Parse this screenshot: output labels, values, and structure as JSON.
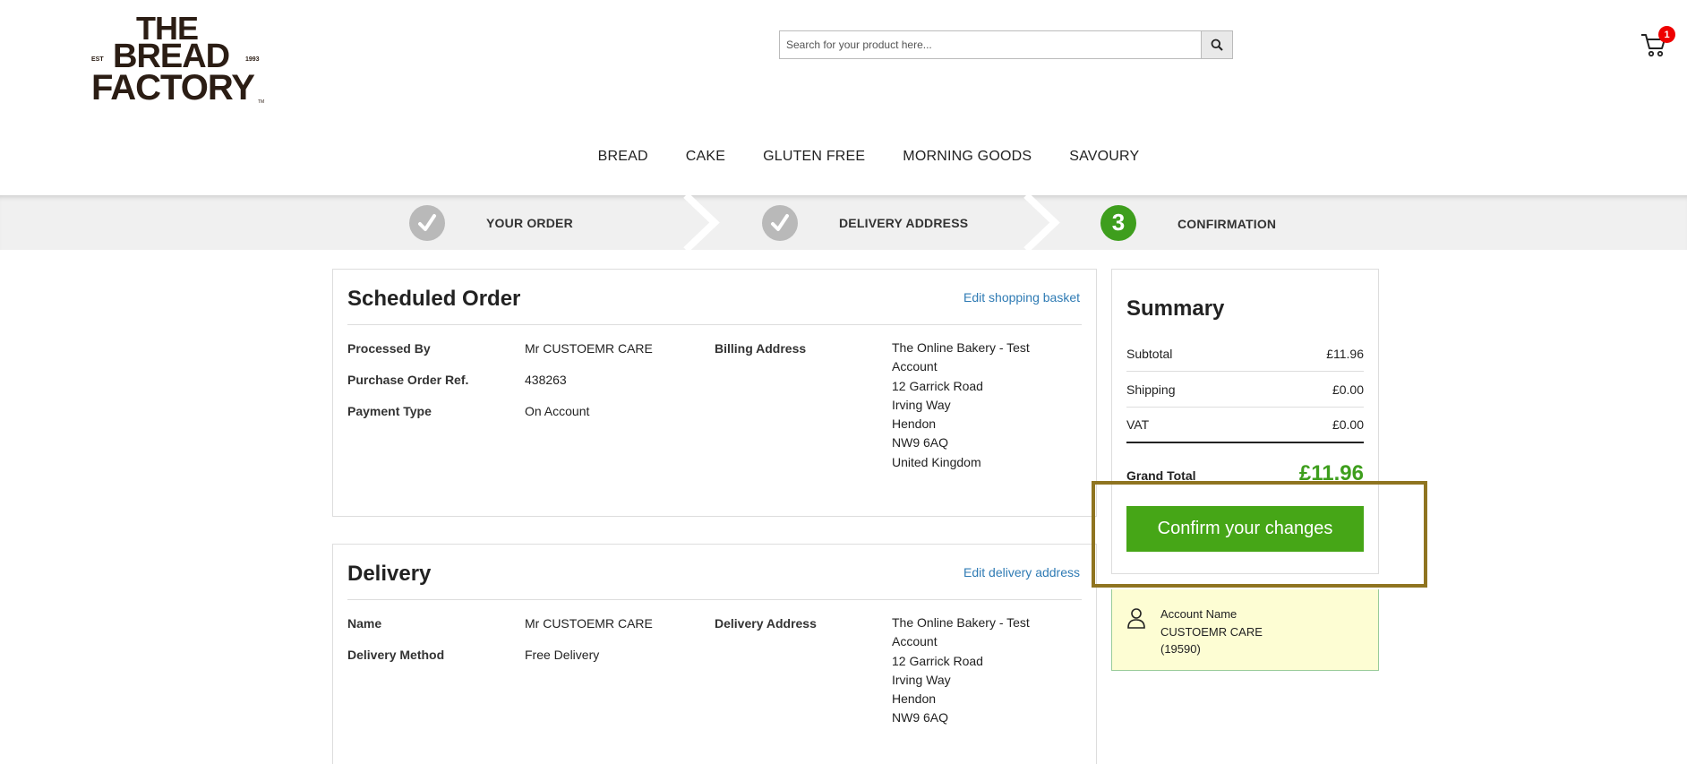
{
  "header": {
    "logo": {
      "line1": "THE",
      "line2": "BREAD",
      "line3": "FACTORY",
      "est": "EST",
      "year": "1993",
      "tm": "TM"
    },
    "search": {
      "placeholder": "Search for your product here..."
    },
    "cart": {
      "count": "1"
    }
  },
  "nav": {
    "items": [
      "BREAD",
      "CAKE",
      "GLUTEN FREE",
      "MORNING GOODS",
      "SAVOURY"
    ]
  },
  "progress": {
    "steps": [
      {
        "label": "YOUR ORDER",
        "state": "done"
      },
      {
        "label": "DELIVERY ADDRESS",
        "state": "done"
      },
      {
        "label": "CONFIRMATION",
        "state": "active",
        "number": "3"
      }
    ]
  },
  "order": {
    "title": "Scheduled Order",
    "edit_link": "Edit shopping basket",
    "processed_by_label": "Processed By",
    "processed_by": "Mr CUSTOEMR CARE",
    "po_label": "Purchase Order Ref.",
    "po": "438263",
    "payment_label": "Payment Type",
    "payment": "On Account",
    "billing_label": "Billing Address",
    "billing_lines": [
      "The Online Bakery - Test",
      "Account",
      "12 Garrick Road",
      "Irving Way",
      "Hendon",
      "NW9 6AQ",
      "United Kingdom"
    ]
  },
  "delivery": {
    "title": "Delivery",
    "edit_link": "Edit delivery address",
    "name_label": "Name",
    "name": "Mr CUSTOEMR CARE",
    "method_label": "Delivery Method",
    "method": "Free Delivery",
    "address_label": "Delivery Address",
    "address_lines": [
      "The Online Bakery - Test",
      "Account",
      "12 Garrick Road",
      "Irving Way",
      "Hendon",
      "NW9 6AQ"
    ]
  },
  "summary": {
    "title": "Summary",
    "subtotal_label": "Subtotal",
    "subtotal": "£11.96",
    "shipping_label": "Shipping",
    "shipping": "£0.00",
    "vat_label": "VAT",
    "vat": "£0.00",
    "grand_label": "Grand Total",
    "grand": "£11.96",
    "confirm_label": "Confirm your changes"
  },
  "account": {
    "label": "Account Name",
    "name": "CUSTOEMR CARE",
    "id": "(19590)"
  },
  "colors": {
    "accent_green": "#46a617",
    "link_blue": "#2f7bb4",
    "highlight": "#8f7420",
    "badge_red": "#ee0000"
  }
}
